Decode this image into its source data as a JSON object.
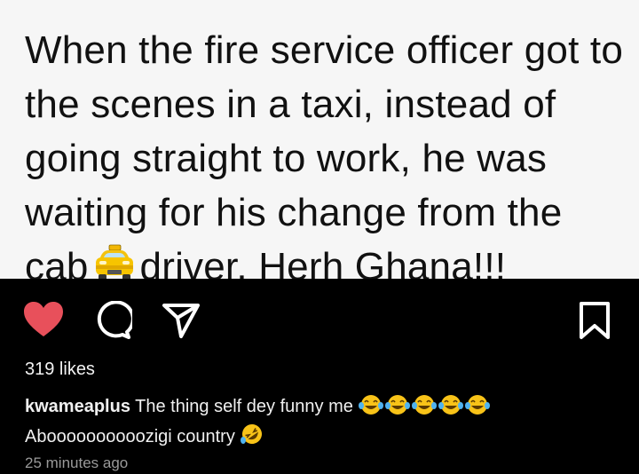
{
  "post": {
    "text": "When the fire service officer got to the scenes in a taxi, instead of going straight to work, he was waiting for his change from the cab",
    "text_after_emoji": "driver. Herh Ghana!!!",
    "inline_emoji": "taxi-emoji"
  },
  "actions": {
    "like_icon": "heart-icon",
    "comment_icon": "comment-icon",
    "share_icon": "send-icon",
    "save_icon": "bookmark-icon",
    "liked": true,
    "like_color": "#e8505b"
  },
  "likes": {
    "label": "319 likes"
  },
  "caption": {
    "username": "kwameaplus",
    "text": "The thing self dey funny me",
    "line2": "Aboooooooooozigi country",
    "emojis": [
      "face-with-tears-of-joy",
      "face-with-tears-of-joy",
      "face-with-tears-of-joy",
      "face-with-tears-of-joy",
      "face-with-tears-of-joy",
      "rolling-on-the-floor-laughing"
    ]
  },
  "timestamp": "25 minutes ago"
}
